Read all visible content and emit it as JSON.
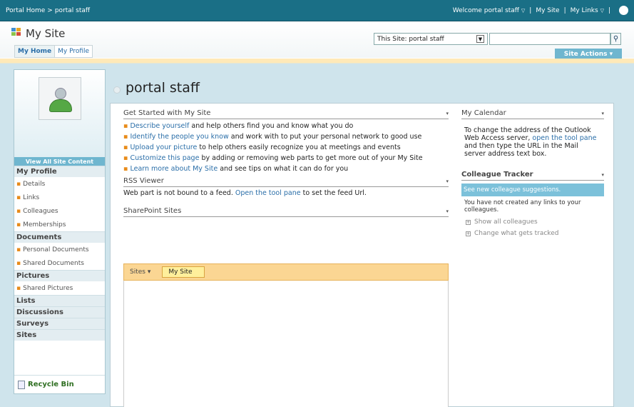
{
  "topbar": {
    "crumb_home": "Portal Home",
    "crumb_sep": ">",
    "crumb_current": "portal staff",
    "welcome": "Welcome portal staff",
    "my_site": "My Site",
    "my_links": "My Links",
    "arrow": "▽",
    "pipe": "|",
    "help": "?"
  },
  "header": {
    "site_title": "My Site",
    "tabs": [
      "My Home",
      "My Profile"
    ],
    "scope_value": "This Site: portal staff",
    "search_placeholder": "",
    "site_actions": "Site Actions ▾"
  },
  "leftnav": {
    "view_all": "View All Site Content",
    "my_profile": "My Profile",
    "profile_items": [
      "Details",
      "Links",
      "Colleagues",
      "Memberships"
    ],
    "documents": "Documents",
    "document_items": [
      "Personal Documents",
      "Shared Documents"
    ],
    "pictures": "Pictures",
    "picture_items": [
      "Shared Pictures"
    ],
    "lists": "Lists",
    "discussions": "Discussions",
    "surveys": "Surveys",
    "sites": "Sites",
    "recycle_bin": "Recycle Bin"
  },
  "main": {
    "page_title": "portal staff",
    "get_started": {
      "title": "Get Started with My Site",
      "items": [
        {
          "link": "Describe yourself",
          "text": " and help others find you and know what you do"
        },
        {
          "link": "Identify the people you know",
          "text": " and work with to put your personal network to good use"
        },
        {
          "link": "Upload your picture",
          "text": " to help others easily recognize you at meetings and events"
        },
        {
          "link": "Customize this page",
          "text": " by adding or removing web parts to get more out of your My Site"
        },
        {
          "link": "Learn more about My Site",
          "text": " and see tips on what it can do for you"
        }
      ]
    },
    "rss": {
      "title": "RSS Viewer",
      "text_before": "Web part is not bound to a feed. ",
      "link": "Open the tool pane",
      "text_after": " to set the feed Url."
    },
    "sp_sites": {
      "title": "SharePoint Sites",
      "sites_label": "Sites ▾",
      "my_site_tab": "My Site"
    },
    "calendar": {
      "title": "My Calendar",
      "text_before": "To change the address of the Outlook Web Access server, ",
      "link": "open the tool pane",
      "text_after": " and then type the URL in the Mail server address text box."
    },
    "colleague_tracker": {
      "title": "Colleague Tracker",
      "suggestions": "See new colleague suggestions.",
      "note": "You have not created any links to your colleagues.",
      "show_all": "Show all colleagues",
      "change_tracked": "Change what gets tracked"
    },
    "webpart_menu": "▾"
  }
}
